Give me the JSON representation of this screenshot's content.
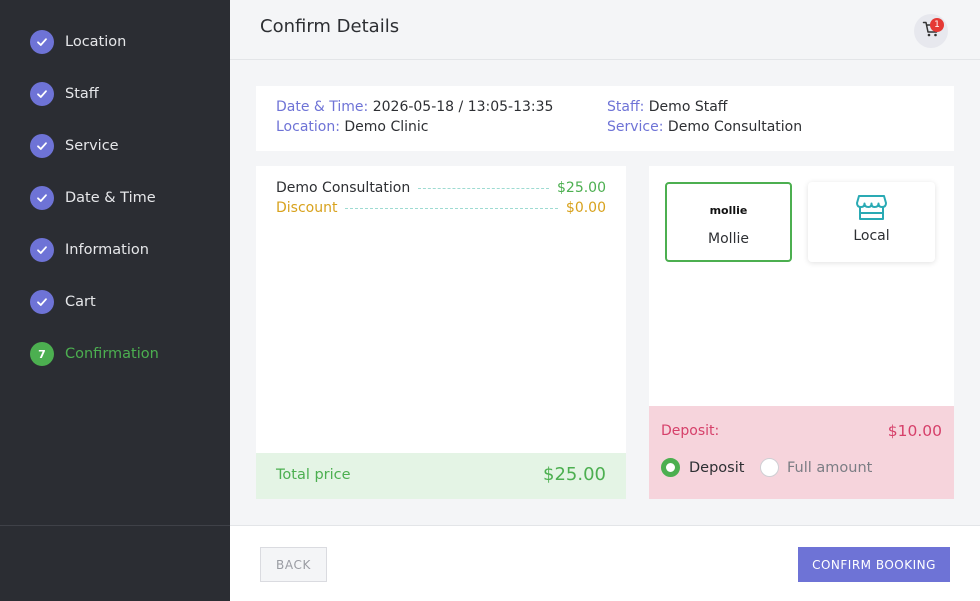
{
  "sidebar": {
    "steps": [
      {
        "label": "Location",
        "status": "done"
      },
      {
        "label": "Staff",
        "status": "done"
      },
      {
        "label": "Service",
        "status": "done"
      },
      {
        "label": "Date & Time",
        "status": "done"
      },
      {
        "label": "Information",
        "status": "done"
      },
      {
        "label": "Cart",
        "status": "done"
      },
      {
        "label": "Confirmation",
        "status": "active",
        "number": "7"
      }
    ],
    "done_icon": "check-icon"
  },
  "header": {
    "title": "Confirm Details",
    "cart_count": "1",
    "cart_icon": "cart-icon"
  },
  "details": {
    "datetime_key": "Date & Time:",
    "datetime_value": "2026-05-18 / 13:05-13:35",
    "location_key": "Location:",
    "location_value": "Demo Clinic",
    "staff_key": "Staff:",
    "staff_value": "Demo Staff",
    "service_key": "Service:",
    "service_value": "Demo Consultation"
  },
  "summary": {
    "items": [
      {
        "name": "Demo Consultation",
        "price": "$25.00"
      },
      {
        "name": "Discount",
        "price": "$0.00"
      }
    ],
    "total_label": "Total price",
    "total_value": "$25.00"
  },
  "payment": {
    "methods": [
      {
        "logo": "mollie",
        "label": "Mollie",
        "selected": true
      },
      {
        "logo": "store-icon",
        "label": "Local",
        "selected": false
      }
    ],
    "deposit_label": "Deposit:",
    "deposit_value": "$10.00",
    "options": [
      {
        "label": "Deposit",
        "selected": true
      },
      {
        "label": "Full amount",
        "selected": false
      }
    ]
  },
  "footer": {
    "back_label": "BACK",
    "confirm_label": "CONFIRM BOOKING"
  },
  "colors": {
    "accent": "#6e73d6",
    "success": "#4caf50",
    "danger": "#d6406a",
    "sidebar_bg": "#2b2d33"
  }
}
